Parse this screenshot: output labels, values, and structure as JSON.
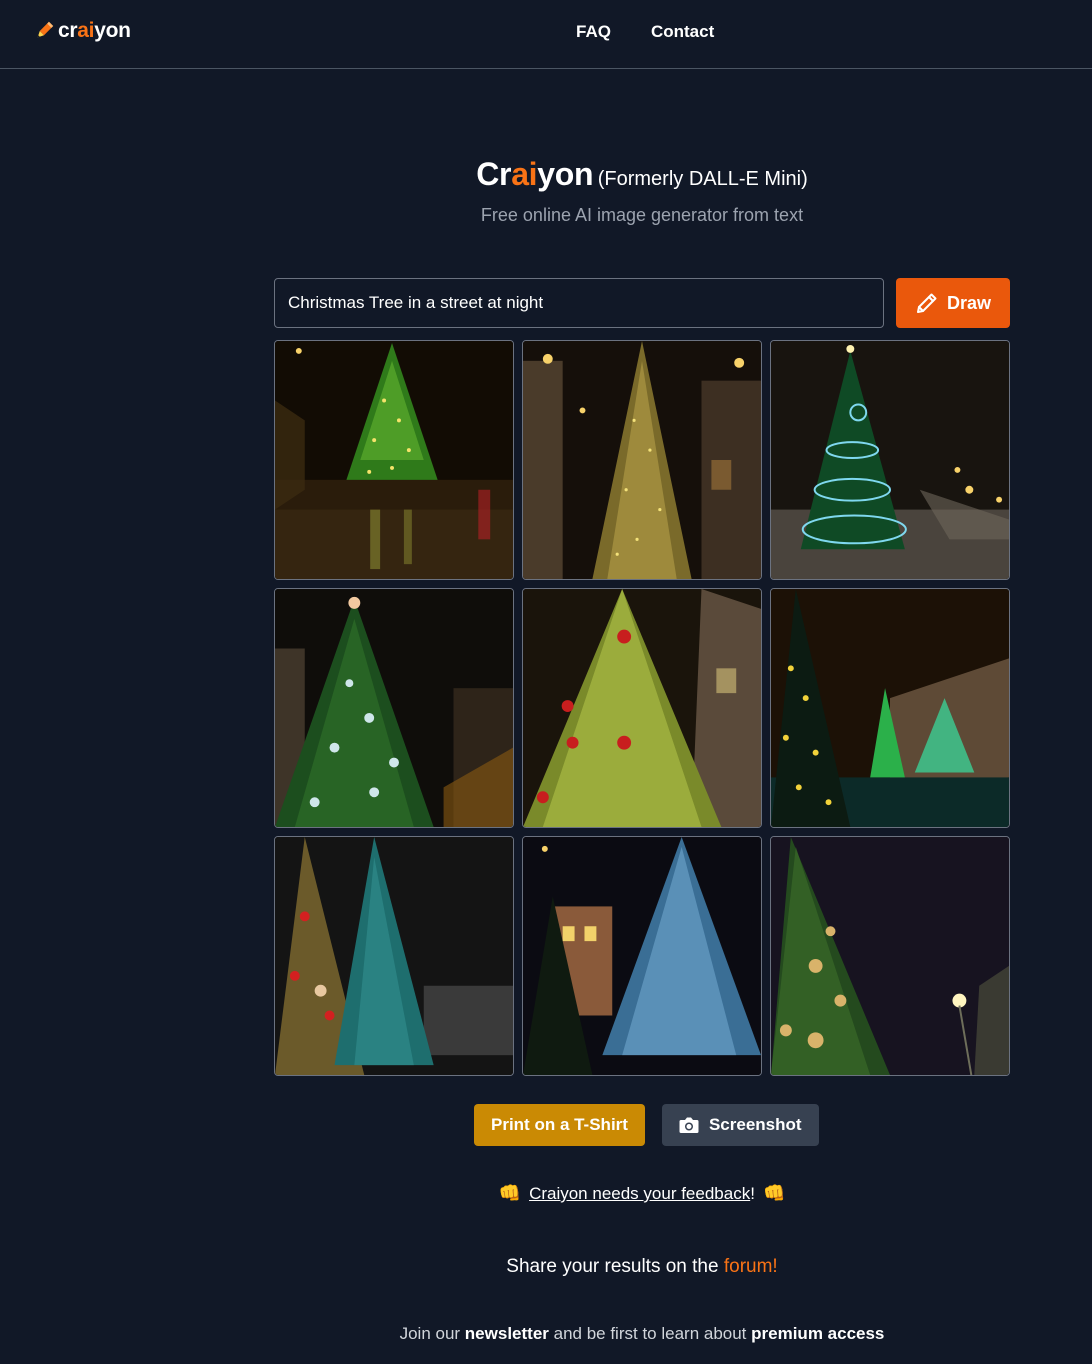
{
  "header": {
    "logo": {
      "prefix": "cr",
      "accent": "ai",
      "suffix": "yon",
      "icon": "pencil-icon"
    },
    "nav": [
      {
        "label": "FAQ"
      },
      {
        "label": "Contact"
      }
    ]
  },
  "hero": {
    "title_prefix": "Cr",
    "title_accent": "ai",
    "title_suffix": "yon",
    "formerly": "(Formerly DALL-E Mini)",
    "subtitle": "Free online AI image generator from text"
  },
  "search": {
    "value": "Christmas Tree in a street at night",
    "draw_label": "Draw",
    "draw_icon": "pencil-icon"
  },
  "results": {
    "count": 9,
    "images": [
      "christmas-tree-image-1",
      "christmas-tree-image-2",
      "christmas-tree-image-3",
      "christmas-tree-image-4",
      "christmas-tree-image-5",
      "christmas-tree-image-6",
      "christmas-tree-image-7",
      "christmas-tree-image-8",
      "christmas-tree-image-9"
    ]
  },
  "actions": {
    "tshirt_label": "Print on a T-Shirt",
    "screenshot_label": "Screenshot",
    "screenshot_icon": "camera-icon"
  },
  "feedback": {
    "emoji": "👊",
    "link_text": "Craiyon needs your feedback",
    "suffix": "!"
  },
  "forum": {
    "prefix": "Share your results on the ",
    "link_text": "forum!"
  },
  "newsletter": {
    "text1": "Join our ",
    "bold1": "newsletter",
    "text2": " and be first to learn about ",
    "bold2": "premium access"
  },
  "colors": {
    "background": "#111827",
    "accent": "#f97316",
    "draw_button": "#ea580c",
    "tshirt_button": "#ca8a04",
    "screenshot_button": "#374151"
  }
}
